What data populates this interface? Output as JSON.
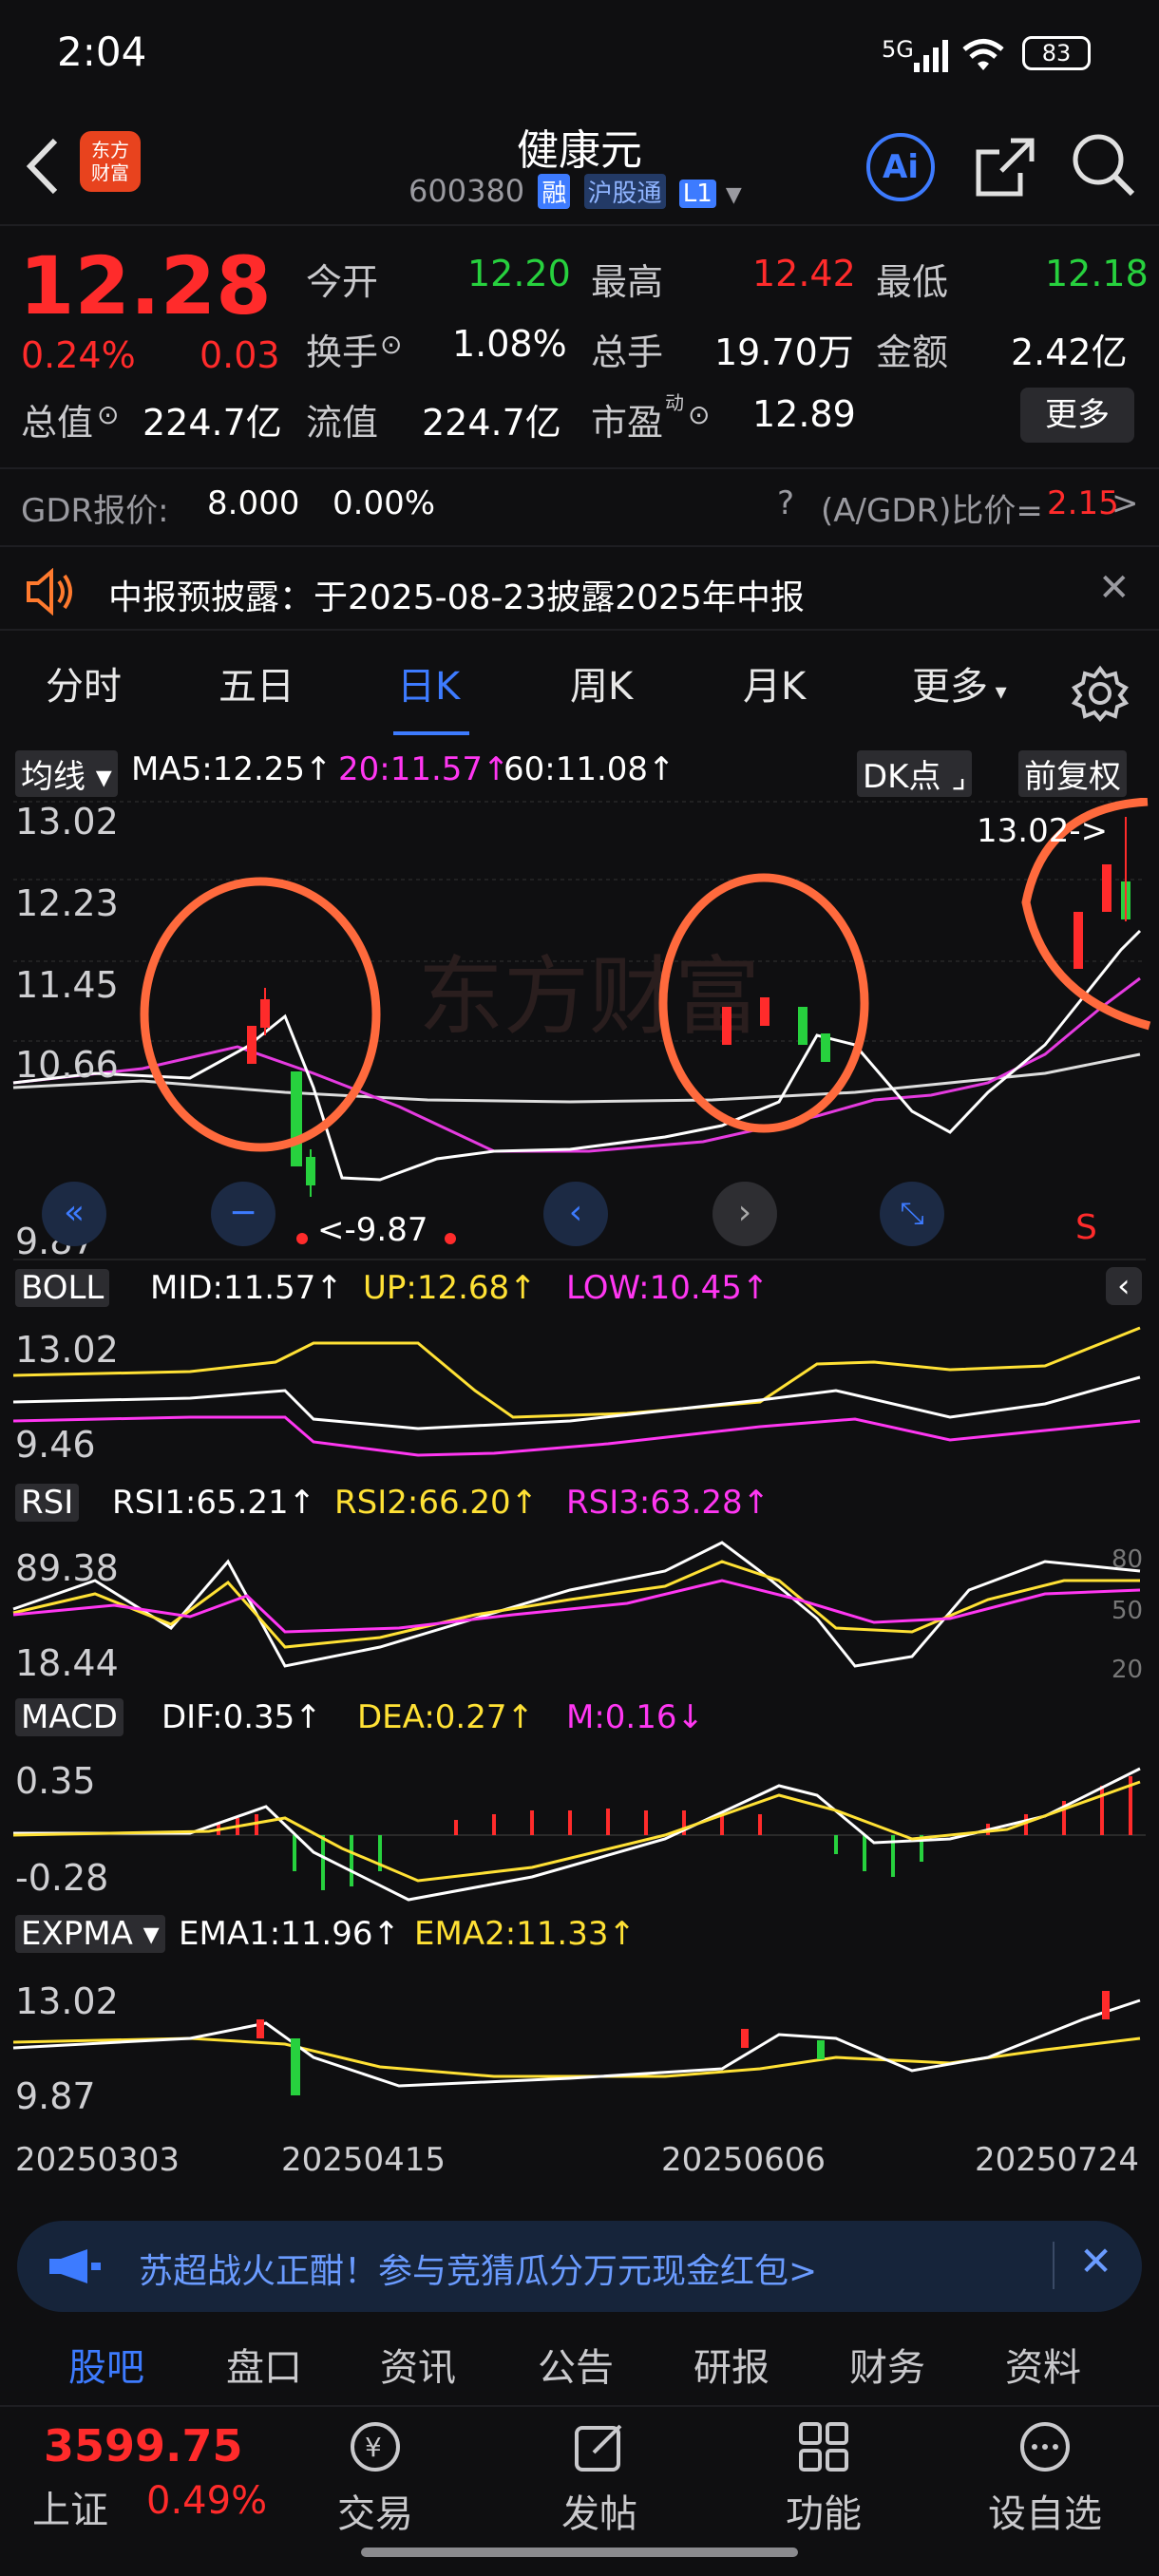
{
  "status_bar": {
    "time": "2:04",
    "network": "5G",
    "battery": "83"
  },
  "header": {
    "logo_line1": "东方",
    "logo_line2": "财富",
    "title": "健康元",
    "code": "600380",
    "tag_margin": "融",
    "tag_connect": "沪股通",
    "tag_level": "L1",
    "ai_label": "Ai"
  },
  "quote": {
    "price": "12.28",
    "change_pct": "0.24%",
    "change": "0.03",
    "open_label": "今开",
    "open": "12.20",
    "high_label": "最高",
    "high": "12.42",
    "low_label": "最低",
    "low": "12.18",
    "turnover_label": "换手",
    "turnover": "1.08%",
    "volume_label": "总手",
    "volume": "19.70万",
    "amount_label": "金额",
    "amount": "2.42亿",
    "mcap_label": "总值",
    "mcap": "224.7亿",
    "float_label": "流值",
    "float": "224.7亿",
    "pe_label": "市盈",
    "pe_sup": "动",
    "pe": "12.89",
    "more_label": "更多"
  },
  "gdr": {
    "label": "GDR报价:",
    "price": "8.000",
    "pct": "0.00%",
    "ratio_label": "(A/GDR)比价=",
    "ratio": "2.15"
  },
  "notice": {
    "text": "中报预披露：于2025-08-23披露2025年中报"
  },
  "tabs": [
    "分时",
    "五日",
    "日K",
    "周K",
    "月K",
    "更多"
  ],
  "main_chart": {
    "ma_box": "均线",
    "ma5": "MA5:12.25↑",
    "ma20": "20:11.57↑",
    "ma60": "60:11.08↑",
    "dk_label": "DK点",
    "fq_label": "前复权",
    "y_labels": [
      "13.02",
      "12.23",
      "11.45",
      "10.66",
      "9.87"
    ],
    "high_marker": "13.02->",
    "low_marker": "<-9.87",
    "s_marker": "S",
    "watermark": "东方财富"
  },
  "boll": {
    "box": "BOLL",
    "mid": "MID:11.57↑",
    "up": "UP:12.68↑",
    "low": "LOW:10.45↑",
    "y_labels": [
      "13.02",
      "9.46"
    ]
  },
  "rsi": {
    "box": "RSI",
    "rsi1": "RSI1:65.21↑",
    "rsi2": "RSI2:66.20↑",
    "rsi3": "RSI3:63.28↑",
    "y_labels": [
      "89.38",
      "18.44"
    ],
    "right_labels": [
      "80",
      "50",
      "20"
    ]
  },
  "macd": {
    "box": "MACD",
    "dif": "DIF:0.35↑",
    "dea": "DEA:0.27↑",
    "m": "M:0.16↓",
    "y_labels": [
      "0.35",
      "-0.28"
    ]
  },
  "expma": {
    "box": "EXPMA",
    "ema1": "EMA1:11.96↑",
    "ema2": "EMA2:11.33↑",
    "y_labels": [
      "13.02",
      "9.87"
    ]
  },
  "x_dates": [
    "20250303",
    "20250415",
    "20250606",
    "20250724"
  ],
  "banner": {
    "text": "苏超战火正酣！参与竞猜瓜分万元现金红包>"
  },
  "bottom_tabs": [
    "股吧",
    "盘口",
    "资讯",
    "公告",
    "研报",
    "财务",
    "资料"
  ],
  "dock": {
    "index_value": "3599.75",
    "index_name": "上证",
    "index_pct": "0.49%",
    "trade": "交易",
    "post": "发帖",
    "func": "功能",
    "watch": "设自选"
  },
  "colors": {
    "up": "#ff2b2b",
    "down": "#27d13e",
    "accent": "#3d7bff",
    "annotation": "#ff6a3d"
  }
}
